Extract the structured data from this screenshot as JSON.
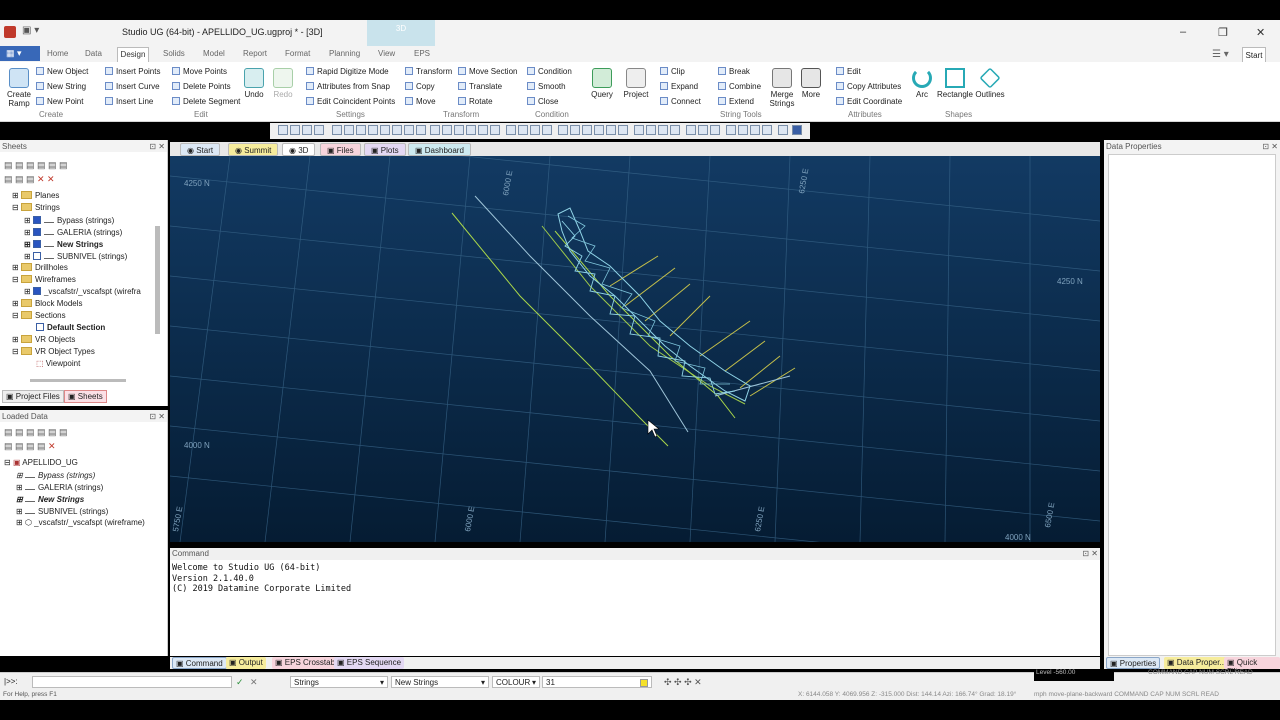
{
  "window": {
    "title": "Studio UG (64-bit) - APELLIDO_UG.ugproj * - [3D]",
    "active_tab": "3D"
  },
  "menus": [
    "Home",
    "Data",
    "Design",
    "Solids",
    "Model",
    "Report",
    "Format",
    "Planning",
    "View",
    "EPS"
  ],
  "start_button": "Start",
  "ribbon": {
    "create": {
      "big": [
        "Create Ramp"
      ],
      "items": [
        "New Object",
        "New String",
        "New Point"
      ],
      "label": "Create"
    },
    "edit": {
      "items": [
        "Insert Points",
        "Insert Curve",
        "Insert Line",
        "Move Points",
        "Delete Points",
        "Delete Segment"
      ],
      "big": [
        "Undo",
        "Redo"
      ],
      "label": "Edit"
    },
    "settings": {
      "items": [
        "Rapid Digitize Mode",
        "Attributes from Snap",
        "Edit Coincident Points"
      ],
      "label": "Settings"
    },
    "transform": {
      "items": [
        "Transform",
        "Copy",
        "Move",
        "Move Section",
        "Translate",
        "Rotate"
      ],
      "label": "Transform"
    },
    "condition": {
      "items": [
        "Condition",
        "Smooth",
        "Close"
      ],
      "label": "Condition"
    },
    "query": {
      "big": [
        "Query",
        "Project"
      ]
    },
    "stringtools": {
      "items": [
        "Clip",
        "Expand",
        "Connect",
        "Break",
        "Combine",
        "Extend"
      ],
      "big": [
        "Merge Strings",
        "More"
      ],
      "label": "String Tools"
    },
    "attributes": {
      "items": [
        "Edit",
        "Copy Attributes",
        "Edit Coordinate"
      ],
      "label": "Attributes"
    },
    "shapes": {
      "big": [
        "Arc",
        "Rectangle",
        "Outlines"
      ],
      "label": "Shapes"
    }
  },
  "sheets": {
    "title": "Sheets",
    "tree": [
      "Planes",
      "Strings",
      "Bypass (strings)",
      "GALERIA (strings)",
      "New Strings",
      "SUBNIVEL (strings)",
      "Drillholes",
      "Wireframes",
      "_vscafstr/_vscafspt (wirefra",
      "Block Models",
      "Sections",
      "Default Section",
      "VR Objects",
      "VR Object Types",
      "Viewpoint"
    ],
    "tabs": [
      "Project Files",
      "Sheets"
    ]
  },
  "loaded": {
    "title": "Loaded Data",
    "tree": [
      "APELLIDO_UG",
      "Bypass (strings)",
      "GALERIA (strings)",
      "New Strings",
      "SUBNIVEL (strings)",
      "_vscafstr/_vscafspt (wireframe)"
    ]
  },
  "view_tabs": [
    "Start",
    "Summit",
    "3D",
    "Files",
    "Plots",
    "Dashboard"
  ],
  "view_labels": [
    "4250 N",
    "6000 E",
    "6250 E",
    "4250 N",
    "4000 N",
    "5750 E",
    "6000 E",
    "6250 E",
    "6500 E",
    "4000 N"
  ],
  "command": {
    "title": "Command",
    "lines": [
      "Welcome to Studio UG (64-bit)",
      "Version 2.1.40.0",
      "(C) 2019 Datamine Corporate Limited"
    ]
  },
  "bottom_tabs": [
    "Command",
    "Output",
    "EPS Crosstab",
    "EPS Sequence"
  ],
  "data_properties": {
    "title": "Data Properties"
  },
  "right_tabs": [
    "Properties",
    "Data Proper...",
    "Quick Filter"
  ],
  "status": {
    "prompt": "|>>:",
    "object": "Strings",
    "string": "New Strings",
    "attribute": "COLOUR",
    "value": "31",
    "level": "Level -560.00",
    "flags": "COMMAND  CAP  NUM  SCRL  READ"
  },
  "help": {
    "left": "For Help, press F1",
    "coords": "X: 6144.058  Y: 4069.956  Z: -315.000  Dist: 144.14  Azi: 166.74°  Grad: 18.19°",
    "right": "mph move-plane-backward  COMMAND  CAP  NUM  SCRL  READ"
  }
}
